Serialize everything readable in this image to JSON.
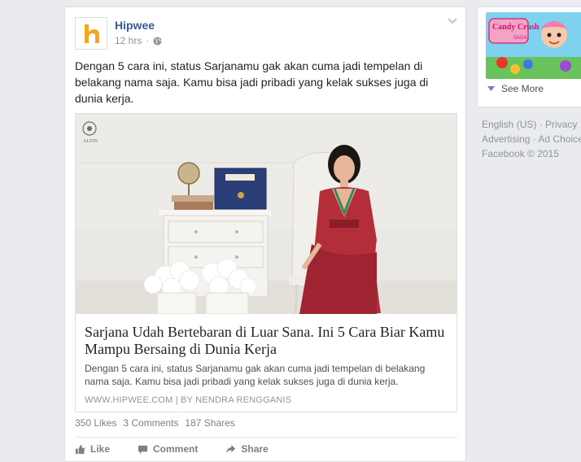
{
  "post": {
    "author": "Hipwee",
    "time": "12 hrs",
    "text": "Dengan 5 cara ini, status Sarjanamu gak akan cuma jadi tempelan di belakang nama saja. Kamu bisa jadi pribadi yang kelak sukses juga di dunia kerja.",
    "link": {
      "watermark": "ALVIN",
      "title": "Sarjana Udah Bertebaran di Luar Sana. Ini 5 Cara Biar Kamu Mampu Bersaing di Dunia Kerja",
      "description": "Dengan 5 cara ini, status Sarjanamu gak akan cuma jadi tempelan di belakang nama saja. Kamu bisa jadi pribadi yang kelak sukses juga di dunia kerja.",
      "source": "WWW.HIPWEE.COM | BY NENDRA RENGGANIS"
    },
    "stats": {
      "likes": "350 Likes",
      "comments": "3 Comments",
      "shares": "187 Shares"
    },
    "actions": {
      "like": "Like",
      "comment": "Comment",
      "share": "Share"
    }
  },
  "sidebar": {
    "ad_logo_text": "Candy Crush",
    "ad_logo_sub": "SAGA",
    "see_more": "See More",
    "footer": {
      "language": "English (US)",
      "privacy": "Privacy",
      "advertising": "Advertising",
      "ad_choices": "Ad Choices",
      "copyright": "Facebook © 2015"
    }
  },
  "colors": {
    "brand_link": "#3b5998",
    "page_bg": "#e9ebee",
    "logo_orange": "#f5a623"
  }
}
